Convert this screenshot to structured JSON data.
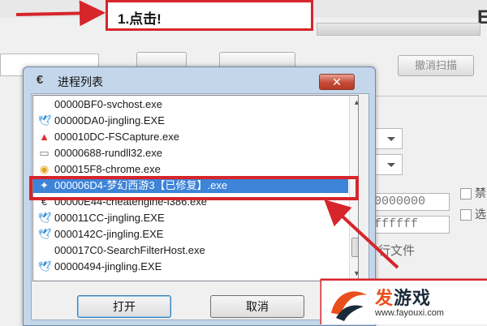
{
  "annotation": {
    "step_text": "1.点击!"
  },
  "main_window": {
    "cancel_scan_label": "撤消扫描",
    "hex_values": [
      "0000000",
      "ffffff"
    ],
    "checkbox_labels": [
      "禁",
      "选"
    ],
    "file_text": "行文件",
    "edge_glyph": "E"
  },
  "dialog": {
    "title": "进程列表",
    "close_glyph": "✕",
    "processes": [
      {
        "name": "00000BF0-svchost.exe",
        "icon": "blank-icon",
        "selected": false
      },
      {
        "name": "00000DA0-jingling.EXE",
        "icon": "bird-icon",
        "selected": false
      },
      {
        "name": "000010DC-FSCapture.exe",
        "icon": "capture-icon",
        "selected": false
      },
      {
        "name": "00000688-rundll32.exe",
        "icon": "file-icon",
        "selected": false
      },
      {
        "name": "000015F8-chrome.exe",
        "icon": "chrome-icon",
        "selected": false
      },
      {
        "name": "000006D4-梦幻西游3【已修复】.exe",
        "icon": "game-icon",
        "selected": true
      },
      {
        "name": "00000E44-cheatengine-i386.exe",
        "icon": "cheatengine-icon",
        "selected": false
      },
      {
        "name": "000011CC-jingling.EXE",
        "icon": "bird-icon",
        "selected": false
      },
      {
        "name": "0000142C-jingling.EXE",
        "icon": "bird-icon",
        "selected": false
      },
      {
        "name": "000017C0-SearchFilterHost.exe",
        "icon": "blank-icon",
        "selected": false
      },
      {
        "name": "00000494-jingling.EXE",
        "icon": "bird-icon",
        "selected": false
      }
    ],
    "open_label": "打开",
    "cancel_label": "取消"
  },
  "watermark": {
    "brand_a": "发",
    "brand_b": "游戏",
    "url": "www.fayouxi.com"
  },
  "colors": {
    "annotation_red": "#d6252b",
    "selection_blue": "#3d83d8"
  }
}
